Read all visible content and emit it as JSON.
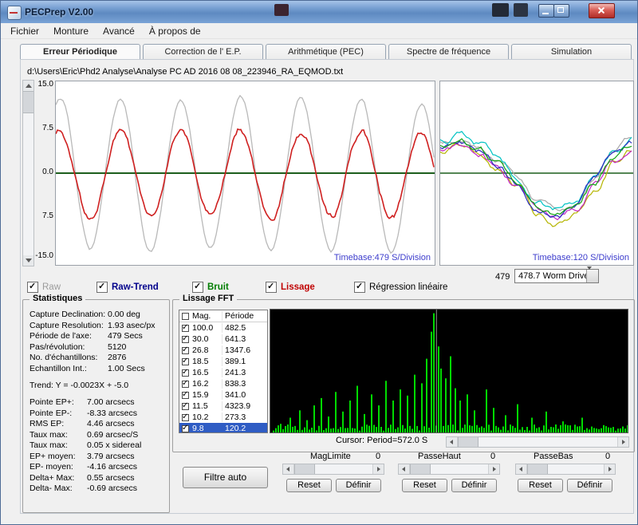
{
  "window": {
    "title": "PECPrep V2.00"
  },
  "menu": {
    "items": [
      "Fichier",
      "Monture",
      "Avancé",
      "À propos de"
    ]
  },
  "tabs": [
    "Erreur Périodique",
    "Correction de l' E.P.",
    "Arithmétique (PEC)",
    "Spectre de fréquence",
    "Simulation"
  ],
  "file_path": "d:\\Users\\Eric\\Phd2 Analyse\\Analyse PC AD 2016 08 08_223946_RA_EQMOD.txt",
  "main_chart": {
    "y_ticks": [
      "15.0",
      "7.5",
      "0.0",
      "7.5",
      "-15.0"
    ],
    "timebase": "Timebase:479 S/Division"
  },
  "overlay_chart": {
    "timebase": "Timebase:120 S/Division",
    "position": "479",
    "worm_drive": "478.7 Worm Drive"
  },
  "toggles": [
    {
      "label": "Raw",
      "color": "#9b9b9b",
      "checked": true
    },
    {
      "label": "Raw-Trend",
      "color": "#00008b",
      "checked": true
    },
    {
      "label": "Bruit",
      "color": "#007d00",
      "checked": true
    },
    {
      "label": "Lissage",
      "color": "#c00000",
      "checked": true
    },
    {
      "label": "Régression linéaire",
      "color": "#000000",
      "checked": true
    }
  ],
  "statistics": {
    "title": "Statistiques",
    "rows": [
      {
        "label": "Capture Declination:",
        "value": "0.00 deg"
      },
      {
        "label": "Capture Resolution:",
        "value": "1.93 asec/px"
      },
      {
        "label": "Période de l'axe:",
        "value": "479 Secs"
      },
      {
        "label": "Pas/révolution:",
        "value": "5120"
      },
      {
        "label": "No. d'échantillons:",
        "value": "2876"
      },
      {
        "label": "Echantillon Int.:",
        "value": "1.00 Secs"
      }
    ],
    "trend": "Trend: Y = -0.0023X + -5.0",
    "rows2": [
      {
        "label": "Pointe EP+:",
        "value": "7.00 arcsecs"
      },
      {
        "label": "Pointe EP-:",
        "value": "-8.33 arcsecs"
      },
      {
        "label": "RMS EP:",
        "value": "4.46 arcsecs"
      },
      {
        "label": "Taux max:",
        "value": "0.69 arcsec/S"
      },
      {
        "label": "Taux max:",
        "value": "0.05 x sidereal"
      },
      {
        "label": "EP+ moyen:",
        "value": "3.79 arcsecs"
      },
      {
        "label": "EP- moyen:",
        "value": "-4.16 arcsecs"
      },
      {
        "label": "Delta+ Max:",
        "value": "0.55 arcsecs"
      },
      {
        "label": "Delta- Max:",
        "value": "-0.69 arcsecs"
      }
    ]
  },
  "fft": {
    "title": "Lissage FFT",
    "table": {
      "mag_header": "Mag.",
      "period_header": "Période",
      "rows": [
        {
          "mag": "100.0",
          "periode": "482.5",
          "checked": true
        },
        {
          "mag": "30.0",
          "periode": "641.3",
          "checked": true
        },
        {
          "mag": "26.8",
          "periode": "1347.6",
          "checked": true
        },
        {
          "mag": "18.5",
          "periode": "389.1",
          "checked": true
        },
        {
          "mag": "16.5",
          "periode": "241.3",
          "checked": true
        },
        {
          "mag": "16.2",
          "periode": "838.3",
          "checked": true
        },
        {
          "mag": "15.9",
          "periode": "341.0",
          "checked": true
        },
        {
          "mag": "11.5",
          "periode": "4323.9",
          "checked": true
        },
        {
          "mag": "10.2",
          "periode": "273.3",
          "checked": true
        },
        {
          "mag": "9.8",
          "periode": "120.2",
          "checked": true,
          "selected": true
        }
      ]
    },
    "cursor": "Cursor: Period=572.0 S"
  },
  "filters": {
    "auto_button": "Filtre auto",
    "groups": [
      {
        "label": "MagLimite",
        "value": "0",
        "reset": "Reset",
        "define": "Définir"
      },
      {
        "label": "PasseHaut",
        "value": "0",
        "reset": "Reset",
        "define": "Définir"
      },
      {
        "label": "PasseBas",
        "value": "0",
        "reset": "Reset",
        "define": "Définir"
      }
    ]
  },
  "colors": {
    "raw_curve": "#b9b9b9",
    "smooth_curve": "#cf2020",
    "zero_line": "#1c5e1c",
    "fft_bar": "#00db00",
    "selection": "#2f5cc4",
    "timebase_text": "#3c3ccc"
  }
}
